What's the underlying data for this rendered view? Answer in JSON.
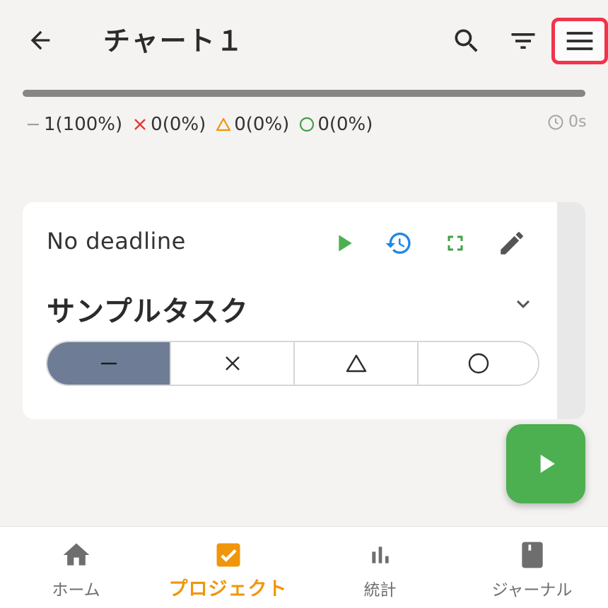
{
  "header": {
    "title": "チャート１"
  },
  "progress": {
    "fill_fraction": 1.0,
    "fill_color": "#868686"
  },
  "stats": [
    {
      "symbol": "dash",
      "text": "1(100%)",
      "color": "#a0a0a0"
    },
    {
      "symbol": "cross",
      "text": "0(0%)",
      "color": "#e53935"
    },
    {
      "symbol": "triangle",
      "text": "0(0%)",
      "color": "#f0960a"
    },
    {
      "symbol": "circle",
      "text": "0(0%)",
      "color": "#43a047"
    }
  ],
  "timer": {
    "text": "0s"
  },
  "card": {
    "deadline": "No deadline",
    "title": "サンプルタスク",
    "selected_index": 0,
    "segments": [
      "dash",
      "cross",
      "triangle",
      "circle"
    ]
  },
  "nav": {
    "items": [
      {
        "label": "ホーム",
        "icon": "home-icon"
      },
      {
        "label": "プロジェクト",
        "icon": "checkbox-icon",
        "active": true
      },
      {
        "label": "統計",
        "icon": "bar-chart-icon"
      },
      {
        "label": "ジャーナル",
        "icon": "journal-icon"
      }
    ]
  },
  "colors": {
    "accent": "#f0960a",
    "play_green": "#4caf50",
    "history_blue": "#1e88e5",
    "segment_active": "#6e7c95",
    "menu_highlight": "#f2334a"
  }
}
